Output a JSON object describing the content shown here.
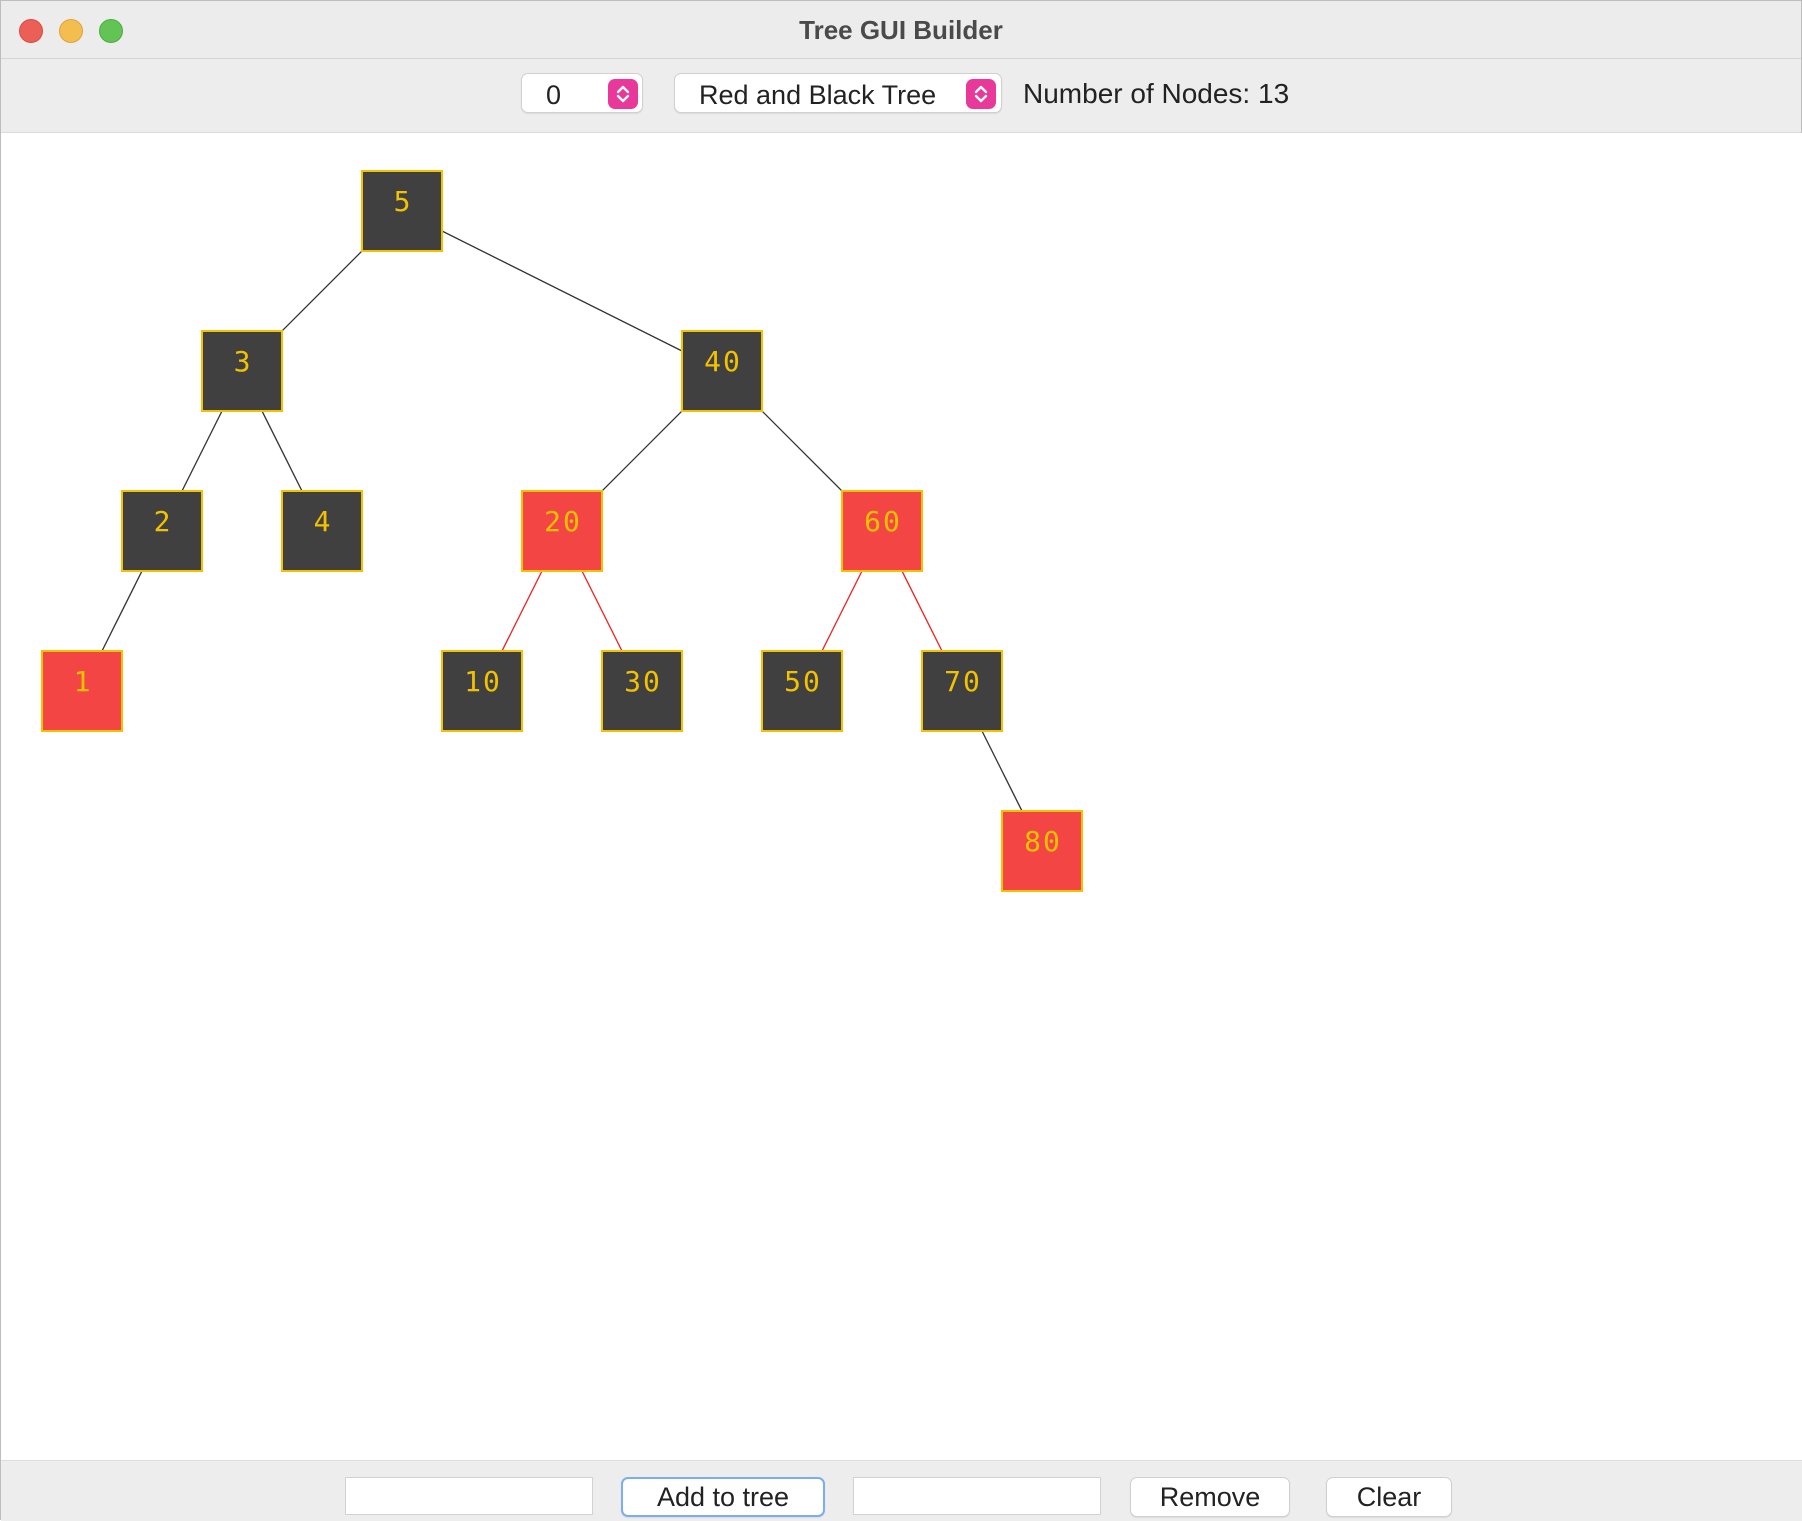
{
  "window": {
    "title": "Tree GUI Builder"
  },
  "toolbar": {
    "number_select": "0",
    "tree_type_select": "Red and Black Tree",
    "node_count_label": "Number of Nodes: 13"
  },
  "colors": {
    "black_node": "#404040",
    "red_node": "#f44545",
    "node_border": "#f2c200",
    "node_text": "#f2c200",
    "black_edge": "#333333",
    "red_edge": "#ee2222",
    "stepper_accent": "#e8399b"
  },
  "tree": {
    "nodes": [
      {
        "id": "n5",
        "value": "5",
        "color": "black",
        "depth": 0,
        "slot": 4
      },
      {
        "id": "n3",
        "value": "3",
        "color": "black",
        "depth": 1,
        "slot": 2
      },
      {
        "id": "n40",
        "value": "40",
        "color": "black",
        "depth": 1,
        "slot": 8
      },
      {
        "id": "n2",
        "value": "2",
        "color": "black",
        "depth": 2,
        "slot": 1
      },
      {
        "id": "n4",
        "value": "4",
        "color": "black",
        "depth": 2,
        "slot": 3
      },
      {
        "id": "n20",
        "value": "20",
        "color": "red",
        "depth": 2,
        "slot": 6
      },
      {
        "id": "n60",
        "value": "60",
        "color": "red",
        "depth": 2,
        "slot": 10
      },
      {
        "id": "n1",
        "value": "1",
        "color": "red",
        "depth": 3,
        "slot": 0
      },
      {
        "id": "n10",
        "value": "10",
        "color": "black",
        "depth": 3,
        "slot": 5
      },
      {
        "id": "n30",
        "value": "30",
        "color": "black",
        "depth": 3,
        "slot": 7
      },
      {
        "id": "n50",
        "value": "50",
        "color": "black",
        "depth": 3,
        "slot": 9
      },
      {
        "id": "n70",
        "value": "70",
        "color": "black",
        "depth": 3,
        "slot": 11
      },
      {
        "id": "n80",
        "value": "80",
        "color": "red",
        "depth": 4,
        "slot": 12
      }
    ],
    "edges": [
      {
        "from": "n5",
        "to": "n3"
      },
      {
        "from": "n5",
        "to": "n40"
      },
      {
        "from": "n3",
        "to": "n2"
      },
      {
        "from": "n3",
        "to": "n4"
      },
      {
        "from": "n2",
        "to": "n1"
      },
      {
        "from": "n40",
        "to": "n20"
      },
      {
        "from": "n40",
        "to": "n60"
      },
      {
        "from": "n20",
        "to": "n10"
      },
      {
        "from": "n20",
        "to": "n30"
      },
      {
        "from": "n60",
        "to": "n50"
      },
      {
        "from": "n60",
        "to": "n70"
      },
      {
        "from": "n70",
        "to": "n80"
      }
    ]
  },
  "bottom": {
    "add_input_value": "",
    "add_button": "Add to tree",
    "remove_input_value": "",
    "remove_button": "Remove",
    "clear_button": "Clear"
  }
}
